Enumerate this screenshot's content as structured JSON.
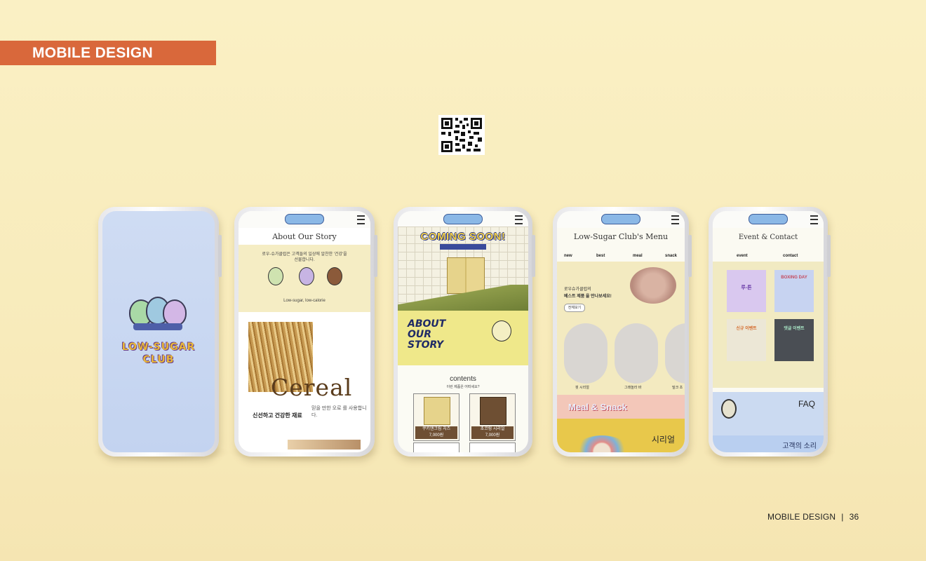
{
  "banner": {
    "label": "MOBILE DESIGN"
  },
  "footer": {
    "label": "MOBILE DESIGN",
    "separator": "|",
    "page": "36"
  },
  "phone1": {
    "logo_line1": "LOW-SUGAR",
    "logo_line2": "CLUB"
  },
  "phone2": {
    "title": "About Our Story",
    "intro": "로우-슈가클럽은 고객들의 일상에 알찬한 '건강'을 선물합니다.",
    "tagline": "Low-sugar, low-calorie",
    "big_word": "Cereal",
    "sub_heading": "신선하고 건강한 재료",
    "side_text": "믿을 만한 오로 를 사용합니다."
  },
  "phone3": {
    "coming": "COMING SOON!",
    "aos_line1": "ABOUT",
    "aos_line2": "OUR",
    "aos_line3": "STORY",
    "contents": "contents",
    "contents_sub": "이런 제품은 어떠세요?",
    "products": [
      {
        "name": "쿠키앤크림 치즈",
        "price": "7,000원"
      },
      {
        "name": "초코링 시리얼",
        "price": "7,000원"
      }
    ]
  },
  "phone4": {
    "title": "Low-Sugar Club's Menu",
    "tabs": [
      "new",
      "best",
      "meal",
      "snack"
    ],
    "best_line1": "로우슈가클럽의",
    "best_line2": "베스트 제품 을 만나보세요!",
    "best_button": "전체보기",
    "items": [
      "핏 시리얼",
      "그래놀라 바",
      "밀크 초"
    ],
    "meal_snack": "Meal & Snack",
    "sireal": "시리얼"
  },
  "phone5": {
    "title": "Event & Contact",
    "tabs": [
      "event",
      "contact"
    ],
    "events": [
      "루-튼",
      "BOXING DAY",
      "신규 이벤트",
      "댓글 이벤트"
    ],
    "faq": "FAQ",
    "voice": "고객의 소리"
  },
  "colors": {
    "background": "#f8ecbb",
    "banner": "#d9683b"
  }
}
